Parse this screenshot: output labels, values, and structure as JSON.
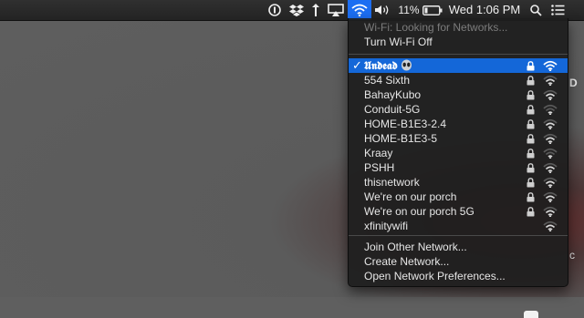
{
  "menubar": {
    "battery_percent": "11%",
    "clock": "Wed 1:06 PM",
    "icons": [
      "onepassword-icon",
      "dropbox-icon",
      "transfer-arrows-icon",
      "airplay-icon",
      "wifi-icon",
      "volume-icon",
      "battery-icon",
      "spotlight-icon",
      "notification-center-icon"
    ]
  },
  "wifi_menu": {
    "status": "Wi-Fi: Looking for Networks...",
    "toggle": "Turn Wi-Fi Off",
    "networks": [
      {
        "name": "𝖀𝖓𝖉𝖊𝖆𝖉",
        "connected": true,
        "locked": true,
        "strength": 4,
        "icon": "alien-icon"
      },
      {
        "name": "554 Sixth",
        "connected": false,
        "locked": true,
        "strength": 3
      },
      {
        "name": "BahayKubo",
        "connected": false,
        "locked": true,
        "strength": 3
      },
      {
        "name": "Conduit-5G",
        "connected": false,
        "locked": true,
        "strength": 2
      },
      {
        "name": "HOME-B1E3-2.4",
        "connected": false,
        "locked": true,
        "strength": 3
      },
      {
        "name": "HOME-B1E3-5",
        "connected": false,
        "locked": true,
        "strength": 3
      },
      {
        "name": "Kraay",
        "connected": false,
        "locked": true,
        "strength": 2
      },
      {
        "name": "PSHH",
        "connected": false,
        "locked": true,
        "strength": 3
      },
      {
        "name": "thisnetwork",
        "connected": false,
        "locked": true,
        "strength": 3
      },
      {
        "name": "We're on our porch",
        "connected": false,
        "locked": true,
        "strength": 3
      },
      {
        "name": "We're on our porch 5G",
        "connected": false,
        "locked": true,
        "strength": 3
      },
      {
        "name": "xfinitywifi",
        "connected": false,
        "locked": false,
        "strength": 3
      }
    ],
    "actions": [
      "Join Other Network...",
      "Create Network...",
      "Open Network Preferences..."
    ]
  },
  "desktop": {
    "glyph_right_1": "D",
    "glyph_right_2": "c"
  },
  "colors": {
    "selection": "#1467d8",
    "menu_bg": "#1e1e1e",
    "menubar_bg": "#2a2a2a"
  }
}
